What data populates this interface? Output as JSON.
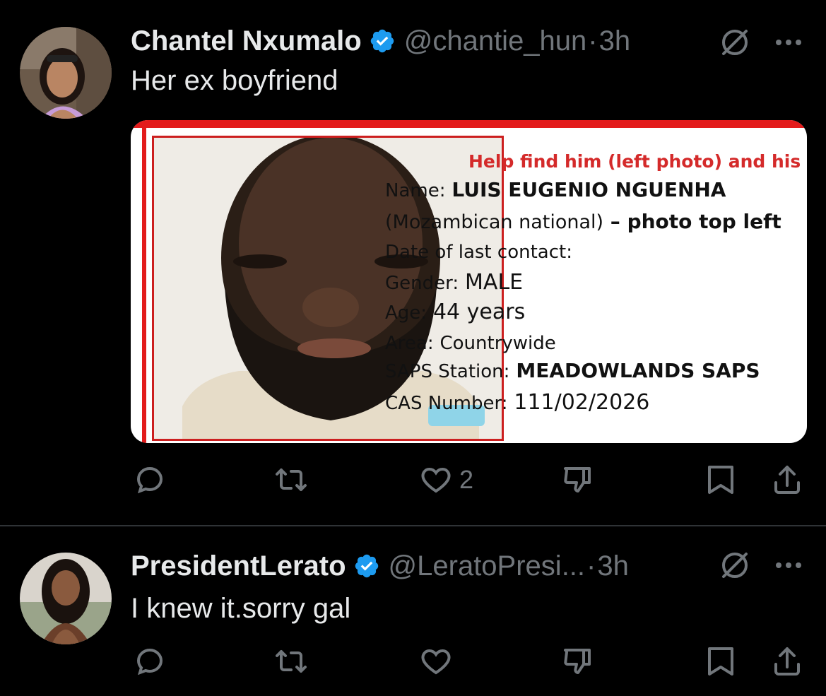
{
  "tweets": [
    {
      "display_name": "Chantel Nxumalo",
      "handle": "@chantie_hun",
      "separator": "·",
      "time": "3h",
      "text": "Her ex boyfriend",
      "avatar_icon": "profile-photo",
      "verified_icon": "verified-badge-icon",
      "media": {
        "headline": "Help find him (left photo) and his pa",
        "name_label": "Name:",
        "name_value": "LUIS EUGENIO NGUENHA",
        "nationality_open": "(Mozambican national)",
        "nationality_dash": " – ",
        "nationality_note": "photo top left",
        "last_contact_label": "Date of last contact:",
        "gender_label": "Gender:",
        "gender_value": "MALE",
        "age_label": "Age:",
        "age_value": "44 years",
        "area_label": "Area:",
        "area_value": "Countrywide",
        "station_label": "SAPS Station:",
        "station_value": "MEADOWLANDS SAPS",
        "cas_label": "CAS Number:",
        "cas_value": "111/02/2026"
      },
      "actions": {
        "reply_count": "",
        "retweet_count": "",
        "like_count": "2",
        "dislike_count": ""
      }
    },
    {
      "display_name": "PresidentLerato",
      "handle": "@LeratoPresi...",
      "separator": "·",
      "time": "3h",
      "text": "I knew it.sorry gal",
      "avatar_icon": "profile-photo",
      "verified_icon": "verified-badge-icon",
      "actions": {
        "reply_count": "",
        "retweet_count": "",
        "like_count": "",
        "dislike_count": ""
      }
    }
  ],
  "colors": {
    "background": "#000000",
    "primary_text": "#e7e9ea",
    "secondary_text": "#71767b",
    "verified_blue": "#1d9bf0",
    "divider": "#2f3336",
    "poster_red": "#e31b1b"
  }
}
